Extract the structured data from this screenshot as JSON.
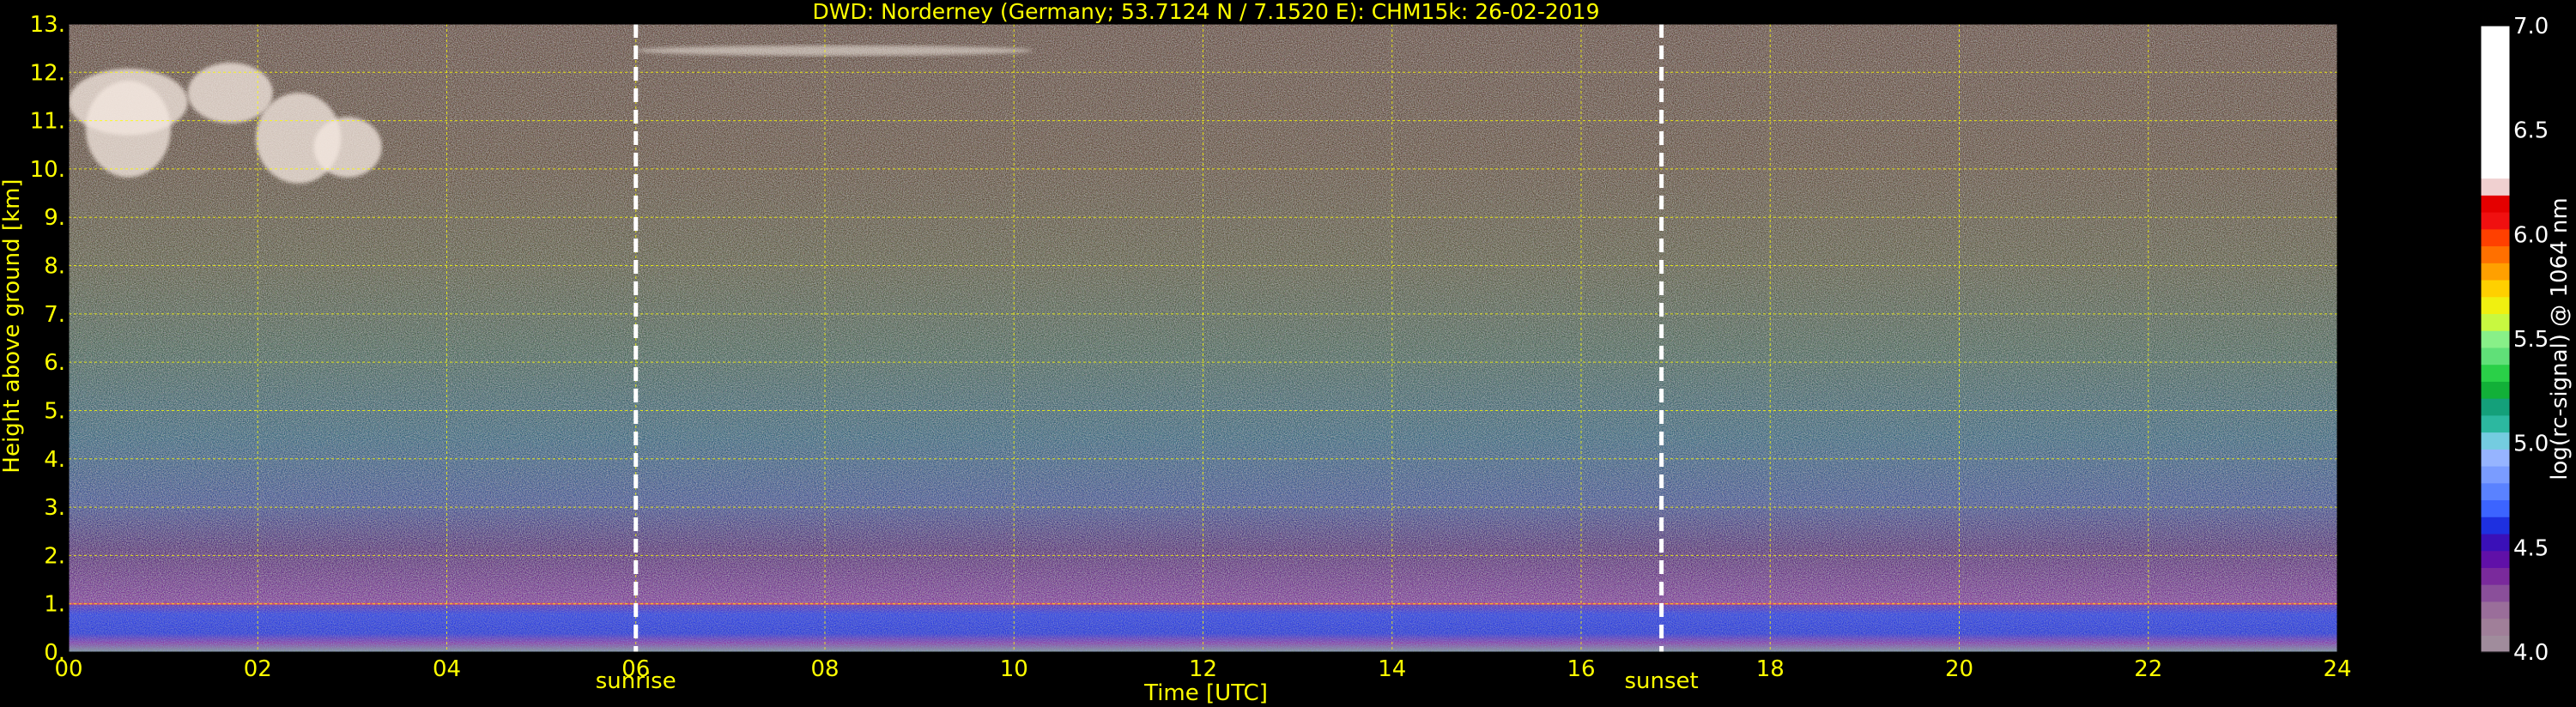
{
  "chart_data": {
    "type": "heatmap",
    "title": "DWD: Norderney (Germany; 53.7124 N / 7.1520 E):    CHM15k: 26-02-2019",
    "xlabel": "Time [UTC]",
    "ylabel": "Height above ground [km]",
    "xlim": [
      0,
      24
    ],
    "ylim": [
      0,
      13
    ],
    "x_ticks": [
      {
        "value": 0,
        "label": "00"
      },
      {
        "value": 2,
        "label": "02"
      },
      {
        "value": 4,
        "label": "04"
      },
      {
        "value": 6,
        "label": "06"
      },
      {
        "value": 8,
        "label": "08"
      },
      {
        "value": 10,
        "label": "10"
      },
      {
        "value": 12,
        "label": "12"
      },
      {
        "value": 14,
        "label": "14"
      },
      {
        "value": 16,
        "label": "16"
      },
      {
        "value": 18,
        "label": "18"
      },
      {
        "value": 20,
        "label": "20"
      },
      {
        "value": 22,
        "label": "22"
      },
      {
        "value": 24,
        "label": "24"
      }
    ],
    "y_ticks": [
      {
        "value": 0,
        "label": "0."
      },
      {
        "value": 1,
        "label": "1."
      },
      {
        "value": 2,
        "label": "2."
      },
      {
        "value": 3,
        "label": "3."
      },
      {
        "value": 4,
        "label": "4."
      },
      {
        "value": 5,
        "label": "5."
      },
      {
        "value": 6,
        "label": "6."
      },
      {
        "value": 7,
        "label": "7."
      },
      {
        "value": 8,
        "label": "8."
      },
      {
        "value": 9,
        "label": "9."
      },
      {
        "value": 10,
        "label": "10."
      },
      {
        "value": 11,
        "label": "11."
      },
      {
        "value": 12,
        "label": "12."
      },
      {
        "value": 13,
        "label": "13."
      }
    ],
    "grid": true,
    "annotations": [
      {
        "label": "sunrise",
        "time": 6.0
      },
      {
        "label": "sunset",
        "time": 16.85
      }
    ],
    "colorbar": {
      "label": "log(rc-signal) @ 1064 nm",
      "range": [
        4.0,
        7.0
      ],
      "ticks": [
        {
          "value": 4.0,
          "label": "4.0"
        },
        {
          "value": 4.5,
          "label": "4.5"
        },
        {
          "value": 5.0,
          "label": "5.0"
        },
        {
          "value": 5.5,
          "label": "5.5"
        },
        {
          "value": 6.0,
          "label": "6.0"
        },
        {
          "value": 6.5,
          "label": "6.5"
        },
        {
          "value": 7.0,
          "label": "7.0"
        }
      ],
      "colors": [
        "#a08c9c",
        "#a07f99",
        "#9a6e9a",
        "#8a4f9a",
        "#7a2a9c",
        "#6010a8",
        "#3a10b8",
        "#1e30e0",
        "#3c64ff",
        "#5a82ff",
        "#7a9cff",
        "#96b4ff",
        "#74cce0",
        "#2cb8a0",
        "#14a07a",
        "#12b038",
        "#2ad048",
        "#60e078",
        "#88f088",
        "#c8f840",
        "#f0f010",
        "#ffd000",
        "#ffa000",
        "#ff7000",
        "#ff4000",
        "#f01010",
        "#e40000",
        "#f0d0d0",
        "#ffffff",
        "#ffffff",
        "#ffffff",
        "#ffffff",
        "#ffffff",
        "#ffffff",
        "#ffffff",
        "#ffffff",
        "#ffffff"
      ]
    },
    "features": {
      "boundary_layer_top_km": 1.0,
      "cirrus_layer": {
        "time_range": [
          0,
          3.6
        ],
        "height_range_km": [
          9.7,
          12.2
        ]
      },
      "upper_cloud_traces": {
        "time_range": [
          6,
          10.2
        ],
        "height_range_km": [
          12.0,
          12.9
        ]
      }
    }
  },
  "colors": {
    "text": "#ffff00",
    "background": "#000000",
    "grid": "#ffff00",
    "annotation_line": "#ffffff",
    "colorbar_text": "#ffffff"
  }
}
